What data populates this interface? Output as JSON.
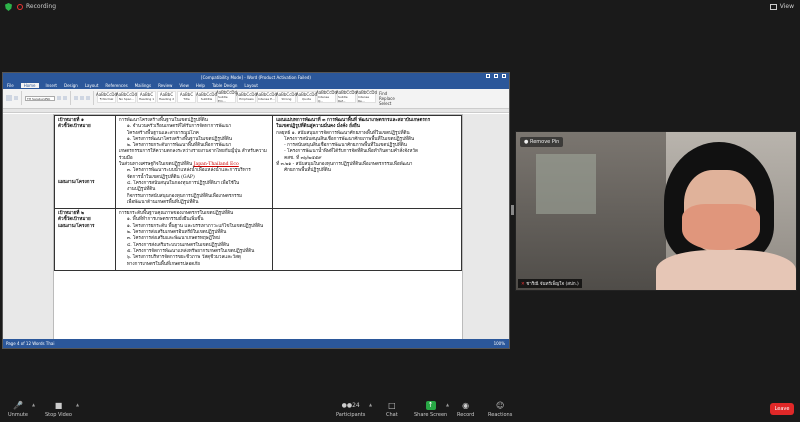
{
  "topbar": {
    "recording_label": "Recording",
    "view_label": "View"
  },
  "word": {
    "title": "[Compatibility Mode] - Word (Product Activation Failed)",
    "tabs": [
      "File",
      "Home",
      "Insert",
      "Design",
      "Layout",
      "References",
      "Mailings",
      "Review",
      "View",
      "Help",
      "Table Design",
      "Layout"
    ],
    "font_name": "TH SarabunPSK",
    "styles": [
      {
        "sample": "AaBbCcDd",
        "name": "¶ Normal"
      },
      {
        "sample": "AaBbCcDd",
        "name": "No Spac..."
      },
      {
        "sample": "AaBbC",
        "name": "Heading 1"
      },
      {
        "sample": "AaBbC",
        "name": "Heading 2"
      },
      {
        "sample": "AaBbC",
        "name": "Title"
      },
      {
        "sample": "AaBbCcDd",
        "name": "Subtitle"
      },
      {
        "sample": "AaBbCcDd",
        "name": "Subtle Em..."
      },
      {
        "sample": "AaBbCcDd",
        "name": "Emphasis"
      },
      {
        "sample": "AaBbCcDd",
        "name": "Intense E..."
      },
      {
        "sample": "AaBbCcDd",
        "name": "Strong"
      },
      {
        "sample": "AaBbCcDd",
        "name": "Quote"
      },
      {
        "sample": "AaBbCcDd",
        "name": "Intense Q..."
      },
      {
        "sample": "AaBbCcDd",
        "name": "Subtle Ref..."
      },
      {
        "sample": "AaBbCcDd",
        "name": "Intense Re..."
      }
    ],
    "editing": [
      "Find",
      "Replace",
      "Select"
    ],
    "status_left": "Page 4 of 12   Words   Thai",
    "status_zoom": "100%",
    "rows": [
      {
        "c1": [
          "เป้าหมายที่ ๑",
          "ตัวชี้วัดเป้าหมาย",
          "แผนงาน/โครงการ"
        ],
        "c2": [
          "การพัฒนาโครงสร้างพื้นฐานในเขตปฏิรูปที่ดิน",
          "๑. จำนวนครัวเรือนเกษตรที่ได้รับการจัดหาการพัฒนา",
          "โครงสร้างพื้นฐานและสาธารณูปโภค",
          "๑. โครงการพัฒนาโครงสร้างพื้นฐานในเขตปฏิรูปที่ดิน",
          "๒. โครงการยกระดับการพัฒนาพื้นที่ดินเพื่อการพัฒนา",
          "เกษตรกรรมการให้ความตกลงระหว่างรายงานจากไทยกับญี่ปุ่น สำหรับความร่วมมือ",
          "ในส่วนทางเศรษฐกิจในเขตปฏิรูปที่ดิน",
          "Japan-Thailand Eco",
          "๓. โครงการพัฒนาระบบน้ำแหล่งน้ำเพื่อแหล่งน้ำและการบริหาร",
          "จัดการน้ำในเขตปฏิรูปที่ดิน (GAP)",
          "๔. โครงการสนับสนุนในกองทุนการปฏิรูปที่ดินฯ เพื่อใช้ใน",
          "งานปฏิรูปที่ดิน",
          "กิจกรรมการสนับสนุนกองทุนการปฏิรูปที่ดินเพื่อเกษตรกรรม",
          "เพื่อพัฒนาด้านเกษตรพื้นที่ปฏิรูปที่ดิน"
        ],
        "c3": [
          "แผนแม่บทการพัฒนาที่ ๓ การพัฒนาพื้นที่ พัฒนาเกษตรกรและสถาบันเกษตรกร",
          "ในเขตปฏิรูปที่ดินสู่ความมั่นคง มั่งคั่ง ยั่งยืน",
          "กลยุทธ์ ๑. สนับสนุนการจัดการพัฒนาศักยภาพพื้นที่ในเขตปฏิรูปที่ดิน",
          "โครงการสนับสนุนสินเชื่อการพัฒนาศักยภาพพื้นที่ในเขตปฏิรูปที่ดิน",
          "- การสนับสนุนสินเชื่อการพัฒนาศักยภาพพื้นที่ในเขตปฏิรูปที่ดิน",
          "- โครงการพัฒนาน้ำพิษที่ได้รับการจัดที่ดินเพื่อทำกินตามคำสั่งจังหวัด",
          "คสช. ที่ ๓๖/๒๕๕๙",
          "ที่ ๓.๒๑ - สนับสนุนในกองทุนการปฏิรูปที่ดินเพื่อเกษตรกรรมเพื่อพัฒนา",
          "ศักยภาพพื้นที่ปฏิรูปที่ดิน"
        ]
      },
      {
        "c1": [
          "เป้าหมายที่ ๒",
          "ตัวชี้วัดเป้าหมาย",
          "แผนงาน/โครงการ"
        ],
        "c2": [
          "การยกระดับพื้นฐานคุณภาพของเกษตรกรในเขตปฏิรูปที่ดิน",
          "๑. พื้นที่ทำการเกษตรกรรมยั่งยืนเพิ่มขึ้น",
          "๑. โครงการยกระดับ พื้นฐาน และบรรเทาภาวะแก้ไขในเขตปฏิรูปที่ดิน",
          "๒. โครงการส่งเสริมเกษตรอินทรีย์ในเขตปฏิรูปที่ดิน",
          "๓. โครงการส่งเสริมและพัฒนาเกษตรทฤษฎีใหม่",
          "๔. โครงการส่งเสริมระบบวนเกษตรในเขตปฏิรูปที่ดิน",
          "๕. โครงการจัดการพัฒนาแหล่งทรัพยากรเกษตรในเขตปฏิรูปที่ดิน",
          "๖. โครงการบริหารจัดการขยะชีวภาพ วัสดุชีวมวลและวัสดุ",
          "ทางการเกษตรในพื้นที่เกษตรปลอดภัย"
        ],
        "c3": []
      }
    ]
  },
  "video": {
    "pin_label": "Remove Pin",
    "participant_name": "ชาริณี จันทร์เพ็ญใจ (สปก.)"
  },
  "toolbar": {
    "unmute": "Unmute",
    "stop_video": "Stop Video",
    "participants": "Participants",
    "participants_count": "24",
    "chat": "Chat",
    "share_screen": "Share Screen",
    "record": "Record",
    "reactions": "Reactions",
    "leave": "Leave"
  }
}
